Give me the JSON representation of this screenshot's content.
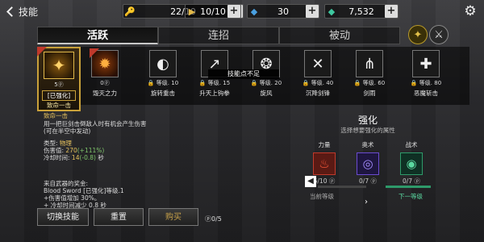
{
  "header": {
    "back_label": "技能",
    "resources": [
      {
        "icon": "key-icon",
        "value": "22/10"
      },
      {
        "icon": "ticket-icon",
        "value": "10/10"
      },
      {
        "icon": "crystal-icon",
        "value": "30"
      },
      {
        "icon": "gem-icon",
        "value": "7,532"
      }
    ]
  },
  "tabs": [
    {
      "label": "活跃",
      "active": true
    },
    {
      "label": "连招",
      "active": false
    },
    {
      "label": "被动",
      "active": false
    }
  ],
  "skills": [
    {
      "name": "致命一击",
      "cost": "5",
      "tag": "[已强化]",
      "selected": true
    },
    {
      "name": "毁灭之力",
      "cost": "0",
      "selected": false
    },
    {
      "name": "旋转重击",
      "lock": "等级. 10"
    },
    {
      "name": "升天上钩拳",
      "lock": "等级. 15"
    },
    {
      "name": "旋风",
      "lock": "等级. 20"
    },
    {
      "name": "沉降剑锋",
      "lock": "等级. 40"
    },
    {
      "name": "剑雨",
      "lock": "等级. 60"
    },
    {
      "name": "恶魔斩击",
      "lock": "等级. 80"
    }
  ],
  "tooltip": "技能点不足",
  "detail": {
    "title": "致命一击",
    "desc1": "用一把巨剑击倒敌人时有机会产生伤害",
    "desc2": "(可在半空中发动)",
    "type_label": "类型:",
    "type_value": "物理",
    "damage_label": "伤害值:",
    "damage_value": "270",
    "damage_bonus": "(+111%)",
    "cooldown_label": "冷却时间:",
    "cooldown_value": "14",
    "cooldown_bonus": "(-0.8)",
    "cooldown_unit": "秒",
    "weapon_bonus_title": "来自武器的奖金:",
    "weapon_line": "Blood Sword [已强化]等级.1",
    "bonus1": "+伤害值增加 30%。",
    "bonus2": "+ 冷却时间减少 0.8 秒"
  },
  "enhance": {
    "title": "强化",
    "subtitle": "选择想要强化的属性",
    "attrs": [
      {
        "label": "力量",
        "count": "5/10",
        "color": "#c0392b",
        "icon": "flame-icon"
      },
      {
        "label": "奥术",
        "count": "0/7",
        "color": "#6a4bd0",
        "icon": "swirl-icon"
      },
      {
        "label": "战术",
        "count": "0/7",
        "color": "#2e9a6a",
        "icon": "spiral-icon"
      }
    ],
    "current_level_label": "当前等级",
    "next_level_label": "下一等级"
  },
  "buttons": {
    "switch_label": "切换技能",
    "reset_label": "重置",
    "buy_label": "购买",
    "points": "0/5"
  }
}
